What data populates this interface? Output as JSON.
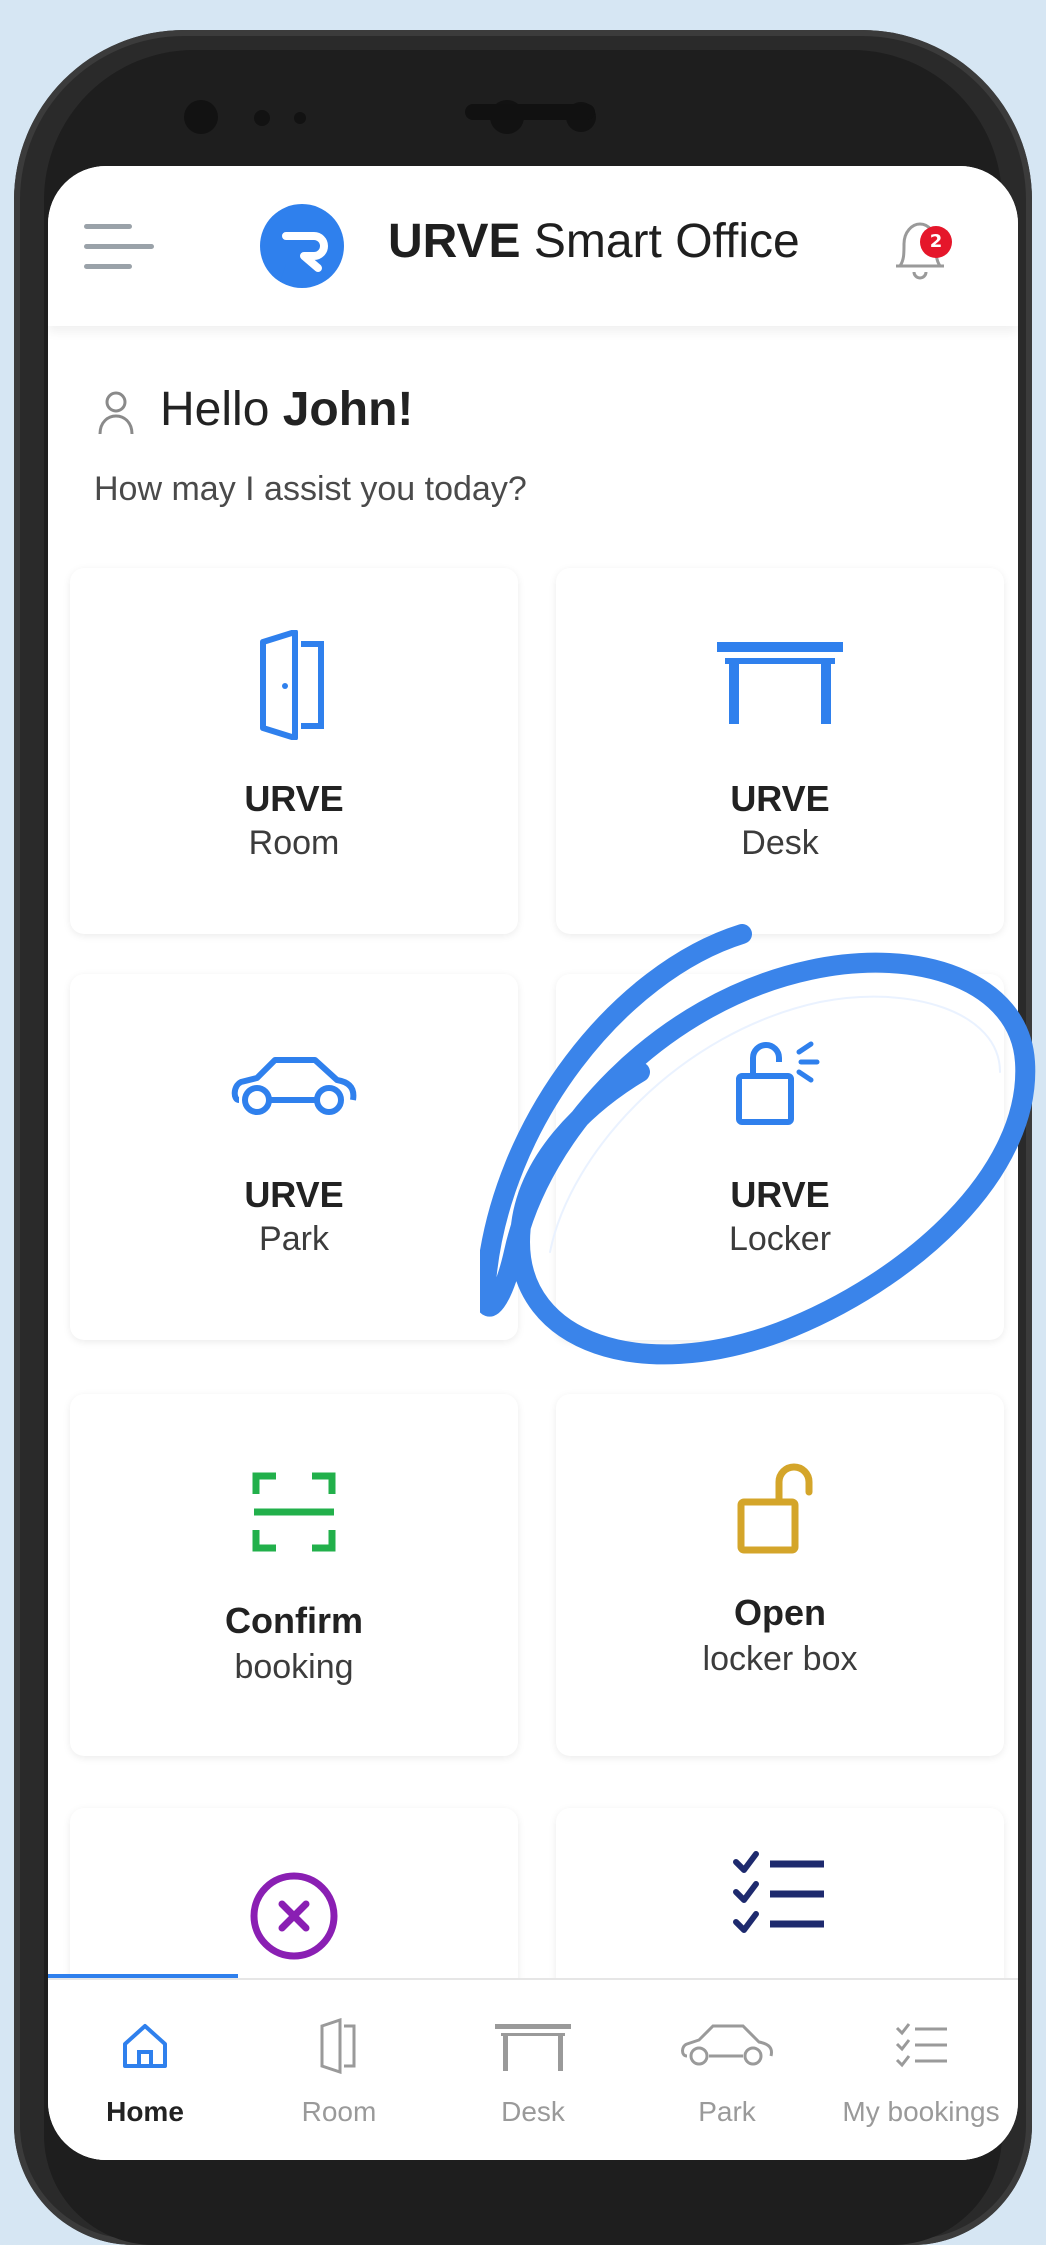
{
  "header": {
    "brand": "URVE",
    "title_rest": "Smart Office",
    "notification_count": "2"
  },
  "greeting": {
    "hello": "Hello",
    "name": "John!",
    "subtitle": "How may I assist you today?"
  },
  "tiles": [
    {
      "line1": "URVE",
      "line2": "Room",
      "icon": "door-icon"
    },
    {
      "line1": "URVE",
      "line2": "Desk",
      "icon": "desk-icon"
    },
    {
      "line1": "URVE",
      "line2": "Park",
      "icon": "car-icon"
    },
    {
      "line1": "URVE",
      "line2": "Locker",
      "icon": "locker-icon"
    },
    {
      "line1": "Confirm",
      "line2": "booking",
      "icon": "scan-icon"
    },
    {
      "line1": "Open",
      "line2": "locker box",
      "icon": "padlock-open-icon"
    },
    {
      "icon": "cancel-icon"
    },
    {
      "icon": "checklist-icon"
    }
  ],
  "bottom_nav": [
    {
      "label": "Home",
      "icon": "home-icon",
      "active": true
    },
    {
      "label": "Room",
      "icon": "door-icon"
    },
    {
      "label": "Desk",
      "icon": "desk-icon"
    },
    {
      "label": "Park",
      "icon": "car-icon"
    },
    {
      "label": "My bookings",
      "icon": "checklist-icon"
    }
  ],
  "colors": {
    "accent": "#2f80ed",
    "confirm_green": "#22b04b",
    "open_gold": "#d4a52a",
    "cancel_purple": "#8a1fb3",
    "badge_red": "#e5162a",
    "navy": "#1e2a6e"
  }
}
